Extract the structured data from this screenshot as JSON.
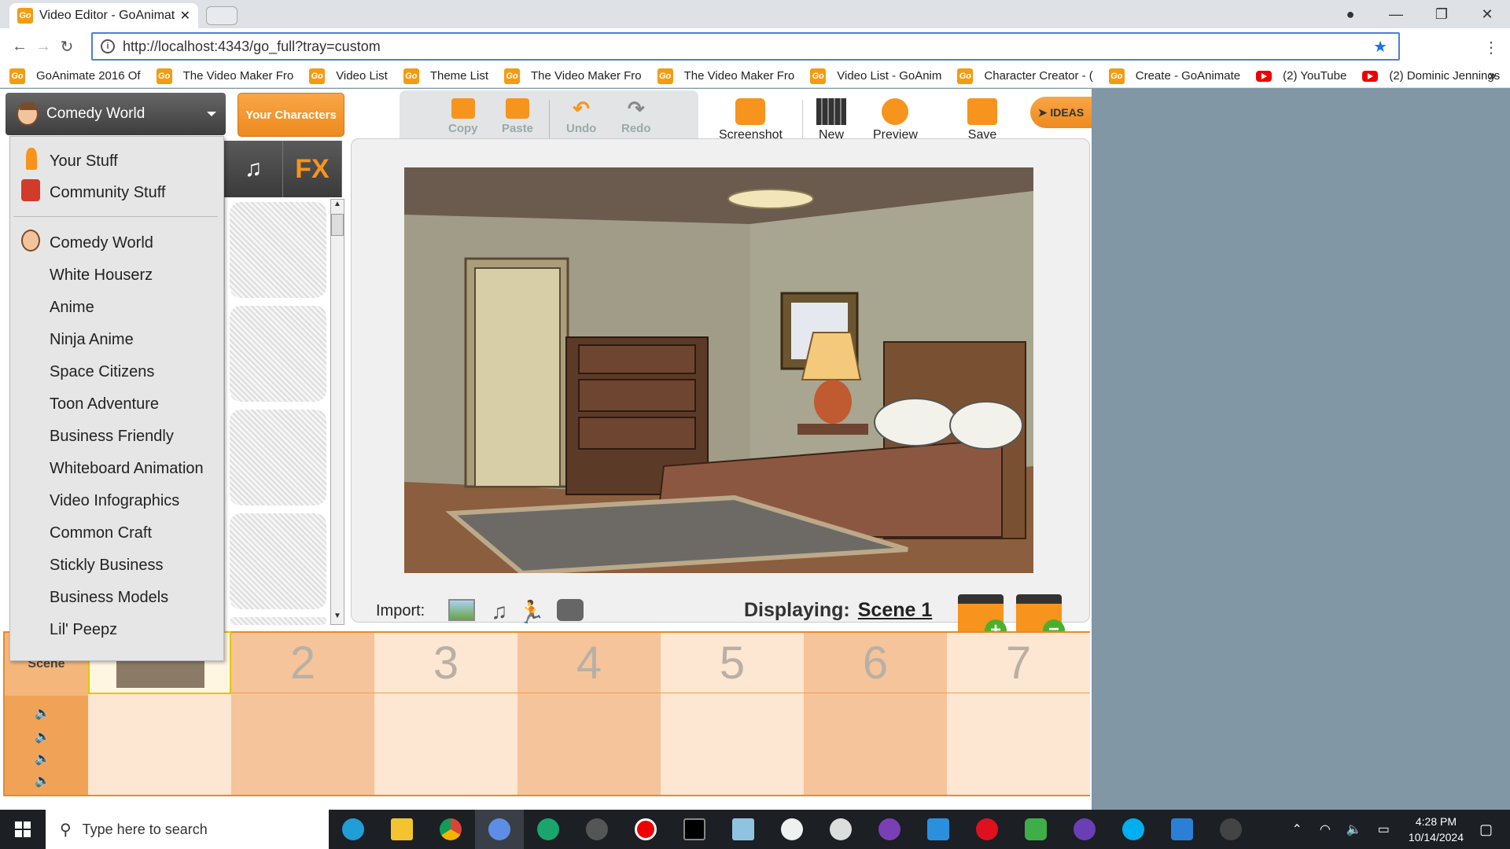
{
  "browser": {
    "tab_title": "Video Editor - GoAnimate",
    "url": "http://localhost:4343/go_full?tray=custom",
    "bookmarks": [
      {
        "label": "GoAnimate 2016 Of",
        "icon": "goanimate-icon"
      },
      {
        "label": "The Video Maker Fro",
        "icon": "goanimate-icon"
      },
      {
        "label": "Video List",
        "icon": "goanimate-icon"
      },
      {
        "label": "Theme List",
        "icon": "goanimate-icon"
      },
      {
        "label": "The Video Maker Fro",
        "icon": "goanimate-icon"
      },
      {
        "label": "The Video Maker Fro",
        "icon": "goanimate-icon"
      },
      {
        "label": "Video List - GoAnim",
        "icon": "goanimate-icon"
      },
      {
        "label": "Character Creator - (",
        "icon": "goanimate-icon"
      },
      {
        "label": "Create - GoAnimate",
        "icon": "goanimate-icon"
      },
      {
        "label": "(2) YouTube",
        "icon": "youtube-icon"
      },
      {
        "label": "(2) Dominic Jennings",
        "icon": "youtube-icon"
      }
    ],
    "more": "»"
  },
  "editor": {
    "theme_selector": "Comedy World",
    "your_characters": "Your Characters",
    "toolbar": {
      "copy": "Copy",
      "paste": "Paste",
      "undo": "Undo",
      "redo": "Redo",
      "screenshot": "Screenshot",
      "new": "New",
      "preview": "Preview",
      "save": "Save",
      "ideas": "IDEAS"
    },
    "tray_tabs": {
      "music": "♫",
      "fx": "FX"
    },
    "theme_menu": {
      "top": [
        "Your Stuff",
        "Community Stuff"
      ],
      "themes": [
        "Comedy World",
        "White Houserz",
        "Anime",
        "Ninja Anime",
        "Space Citizens",
        "Toon Adventure",
        "Business Friendly",
        "Whiteboard Animation",
        "Video Infographics",
        "Common Craft",
        "Stickly Business",
        "Business Models",
        "Lil' Peepz"
      ]
    },
    "import_label": "Import:",
    "displaying_label": "Displaying:",
    "displaying_scene": "Scene 1",
    "timeline": {
      "scene_label": "Scene",
      "numbers": [
        "2",
        "3",
        "4",
        "5",
        "6",
        "7"
      ]
    }
  },
  "taskbar": {
    "search_placeholder": "Type here to search",
    "time": "4:28 PM",
    "date": "10/14/2024"
  }
}
